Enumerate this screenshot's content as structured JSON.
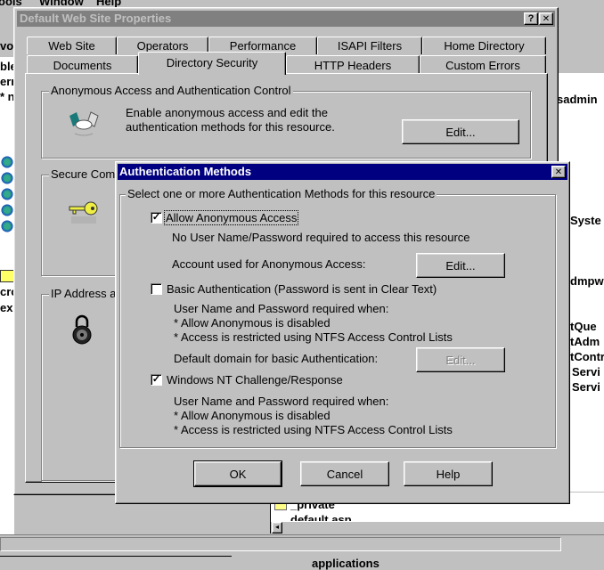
{
  "background_app": {
    "menu": [
      "ools",
      "Window",
      "Help"
    ],
    "left_pane_fragments": [
      "vor",
      "ble",
      "ern",
      "* n",
      "cro",
      "ex"
    ],
    "right_pane_fragments": [
      "sadmin",
      "Syste",
      "dmpw",
      "tQue",
      "tAdm",
      "tContr",
      "Servi",
      "Servi"
    ],
    "file_list": [
      "_private",
      "default.asp"
    ],
    "bottom_fragment": "applications"
  },
  "properties": {
    "title": "Default Web Site Properties",
    "help_btn": "?",
    "close_btn": "✕",
    "tabs_row1": [
      "Web Site",
      "Operators",
      "Performance",
      "ISAPI Filters",
      "Home Directory"
    ],
    "tabs_row2": [
      "Documents",
      "Directory Security",
      "HTTP Headers",
      "Custom Errors"
    ],
    "active_tab": "Directory Security",
    "anon_group": {
      "legend": "Anonymous Access and Authentication Control",
      "text1": "Enable anonymous access and edit the",
      "text2": "authentication methods for this resource.",
      "edit": "Edit..."
    },
    "secure_group": {
      "legend": "Secure Com"
    },
    "ip_group": {
      "legend": "IP Address a"
    }
  },
  "auth_dialog": {
    "title": "Authentication Methods",
    "close_btn": "✕",
    "legend": "Select one or more Authentication Methods for this resource",
    "anonymous": {
      "label": "Allow Anonymous Access",
      "checked": true,
      "desc": "No User Name/Password required to access this resource",
      "account_label": "Account used for Anonymous Access:",
      "edit": "Edit..."
    },
    "basic": {
      "label": "Basic Authentication (Password is sent in Clear Text)",
      "checked": false,
      "desc1": "User Name and Password required when:",
      "desc2": "* Allow Anonymous is disabled",
      "desc3": "* Access is restricted using NTFS Access Control Lists",
      "domain_label": "Default domain for basic Authentication:",
      "edit": "Edit..."
    },
    "ntlm": {
      "label": "Windows NT Challenge/Response",
      "checked": true,
      "desc1": "User Name and Password required when:",
      "desc2": "* Allow Anonymous is disabled",
      "desc3": "* Access is restricted using NTFS Access Control Lists"
    },
    "ok": "OK",
    "cancel": "Cancel",
    "help": "Help"
  },
  "colors": {
    "active_title": "#000080",
    "inactive_title": "#808080",
    "face": "#c0c0c0"
  }
}
